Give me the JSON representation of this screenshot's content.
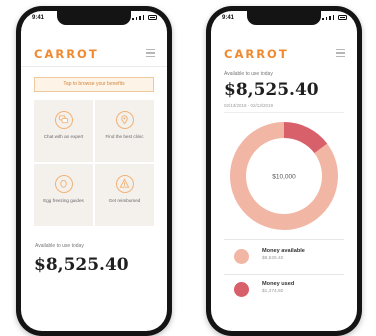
{
  "colors": {
    "brand": "#f0892f",
    "money_available": "#f2b6a5",
    "money_used": "#d7606a",
    "tile_bg": "#f4f0ec"
  },
  "left_screen": {
    "status_time": "9:41",
    "logo": "CARROT",
    "banner": "Tap to browse your benefits",
    "tiles": [
      {
        "label": "Chat with an expert",
        "icon": "chat-icon"
      },
      {
        "label": "Find the best clinic",
        "icon": "location-pin-icon"
      },
      {
        "label": "Egg freezing guides",
        "icon": "egg-icon"
      },
      {
        "label": "Get reimbursed",
        "icon": "dollar-icon"
      }
    ],
    "available_label": "Available to use today",
    "amount": "$8,525.40"
  },
  "right_screen": {
    "status_time": "9:41",
    "logo": "CARROT",
    "available_label": "Available to use today",
    "amount": "$8,525.40",
    "date_range": "02/13/2018 - 02/13/2019",
    "donut_center": "$10,000",
    "legend": [
      {
        "label": "Money available",
        "value": "$8,525.40"
      },
      {
        "label": "Money used",
        "value": "$1,474.60"
      }
    ]
  },
  "chart_data": {
    "type": "pie",
    "total": 10000,
    "series": [
      {
        "name": "Money available",
        "value": 8525.4
      },
      {
        "name": "Money used",
        "value": 1474.6
      }
    ]
  }
}
